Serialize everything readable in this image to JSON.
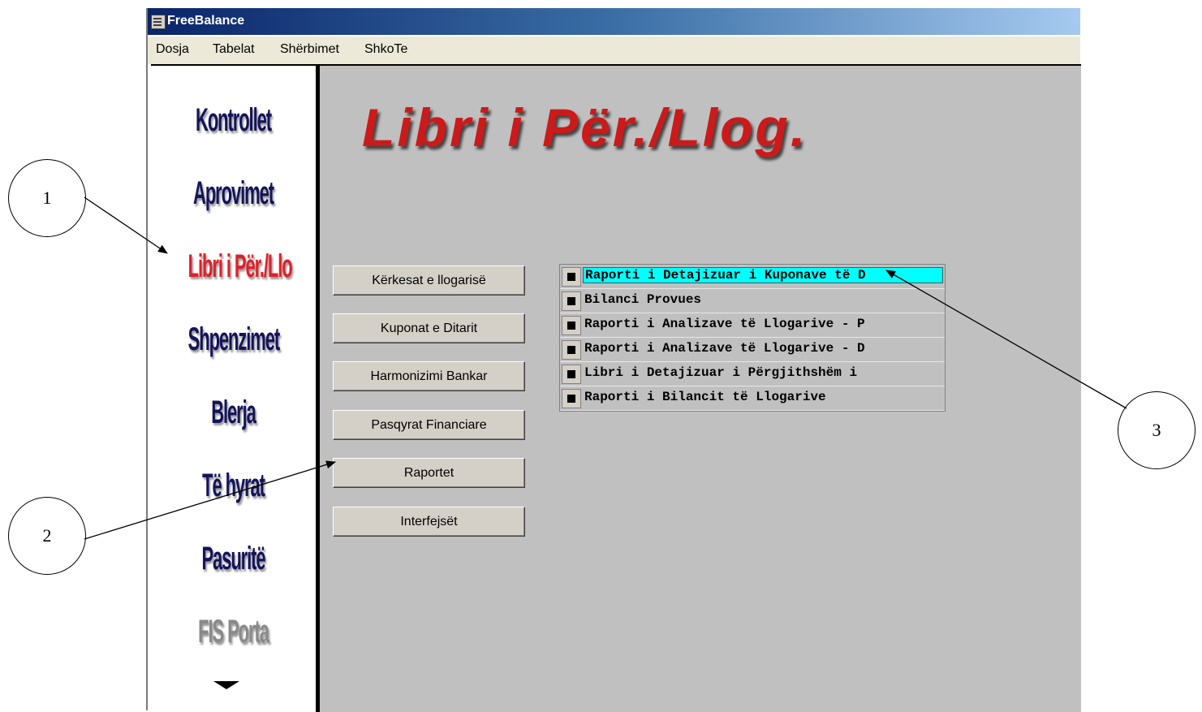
{
  "window": {
    "title": "FreeBalance"
  },
  "menu": [
    "Dosja",
    "Tabelat",
    "Shërbimet",
    "ShkoTe"
  ],
  "sidebar": {
    "items": [
      {
        "label": "Kontrollet",
        "state": "default"
      },
      {
        "label": "Aprovimet",
        "state": "default"
      },
      {
        "label": "Libri i Për./Llo",
        "state": "active"
      },
      {
        "label": "Shpenzimet",
        "state": "default"
      },
      {
        "label": "Blerja",
        "state": "default"
      },
      {
        "label": "Të hyrat",
        "state": "default"
      },
      {
        "label": "Pasuritë",
        "state": "default"
      },
      {
        "label": "FIS Porta",
        "state": "disabled"
      }
    ],
    "more_icon": "down-triangle-icon"
  },
  "main": {
    "title": "Libri i Për./Llog.",
    "buttons": [
      "Kërkesat e llogarisë",
      "Kuponat e Ditarit",
      "Harmonizimi Bankar",
      "Pasqyrat Financiare",
      "Raportet",
      "Interfejsët"
    ],
    "reports": [
      {
        "label": "Raporti i Detajizuar i Kuponave të D",
        "selected": true
      },
      {
        "label": "Bilanci Provues",
        "selected": false
      },
      {
        "label": "Raporti i Analizave të Llogarive - P",
        "selected": false
      },
      {
        "label": "Raporti i Analizave të Llogarive - D",
        "selected": false
      },
      {
        "label": "Libri i Detajizuar i Përgjithshëm i",
        "selected": false
      },
      {
        "label": "Raporti i Bilancit të Llogarive",
        "selected": false
      }
    ]
  },
  "callouts": [
    "1",
    "2",
    "3"
  ],
  "colors": {
    "title_red": "#cc1a1a",
    "active_nav_red": "#e0202a",
    "nav_dark": "#14145a",
    "selection": "#00ffff",
    "panel_gray": "#c0c0c0"
  }
}
